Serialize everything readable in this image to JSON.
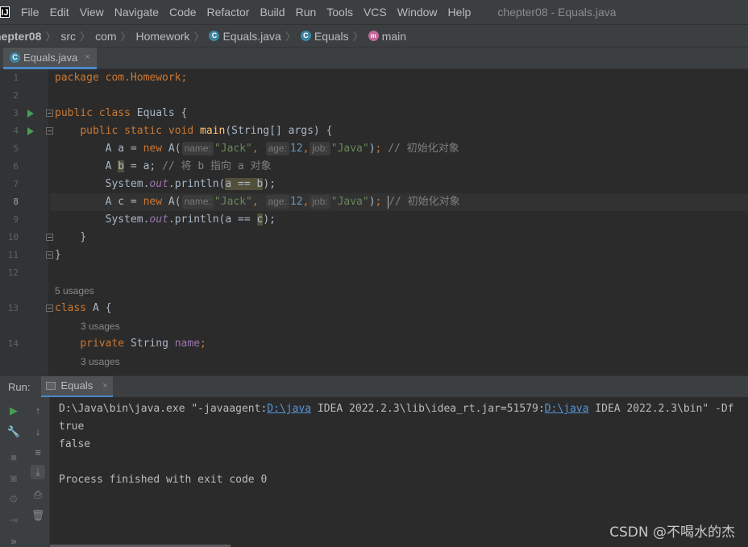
{
  "menubar": {
    "logo": "IJ",
    "items": [
      "File",
      "Edit",
      "View",
      "Navigate",
      "Code",
      "Refactor",
      "Build",
      "Run",
      "Tools",
      "VCS",
      "Window",
      "Help"
    ],
    "window_title": "chepter08 - Equals.java"
  },
  "breadcrumb": {
    "items": [
      "hepter08",
      "src",
      "com",
      "Homework",
      "Equals.java",
      "Equals",
      "main"
    ]
  },
  "editor_tab": {
    "label": "Equals.java",
    "close": "×"
  },
  "gutter": {
    "line_numbers": [
      "1",
      "2",
      "3",
      "4",
      "5",
      "6",
      "7",
      "8",
      "9",
      "10",
      "11",
      "12",
      "13",
      "14"
    ]
  },
  "code": {
    "line1": "package com.Homework;",
    "line3_kw": "public class ",
    "line3_name": "Equals {",
    "line4_kw": "public static void ",
    "line4_fn": "main",
    "line4_rest": "(String[] args) {",
    "line5_a": "A a = ",
    "line5_new": "new ",
    "line5_ctor": "A(",
    "hint_name": "name:",
    "hint_age": "age:",
    "hint_job": "job:",
    "str_jack": "\"Jack\"",
    "num_12": "12",
    "str_java": "\"Java\"",
    "comment_init": "// 初始化对象",
    "line6_a": "A ",
    "line6_b": "b",
    "line6_rest": " = a; ",
    "comment_point": "// 将 b 指向 a 对象",
    "sys": "System.",
    "out": "out",
    "println": ".println(",
    "a_eq_b": "a == b",
    "close_paren": ");",
    "line8_a": "A c = ",
    "line9_a": "a == ",
    "line9_c": "c",
    "brace_close": "}",
    "usage_5": "5 usages",
    "line13_kw": "class ",
    "line13_name": "A {",
    "usage_3": "3 usages",
    "line14_kw": "private ",
    "line14_type": "String ",
    "line14_field": "name",
    "line14_semi": ";"
  },
  "run_panel": {
    "label": "Run:",
    "tab": "Equals",
    "tab_close": "×",
    "console": {
      "cmd_prefix": "D:\\Java\\bin\\java.exe \"-javaagent:",
      "link1": "D:\\java",
      "cmd_mid": " IDEA 2022.2.3\\lib\\idea_rt.jar=51579:",
      "link2": "D:\\java",
      "cmd_suffix": " IDEA 2022.2.3\\bin\" -Df",
      "out1": "true",
      "out2": "false",
      "finish": "Process finished with exit code 0"
    }
  },
  "watermark": "CSDN @不喝水的杰"
}
